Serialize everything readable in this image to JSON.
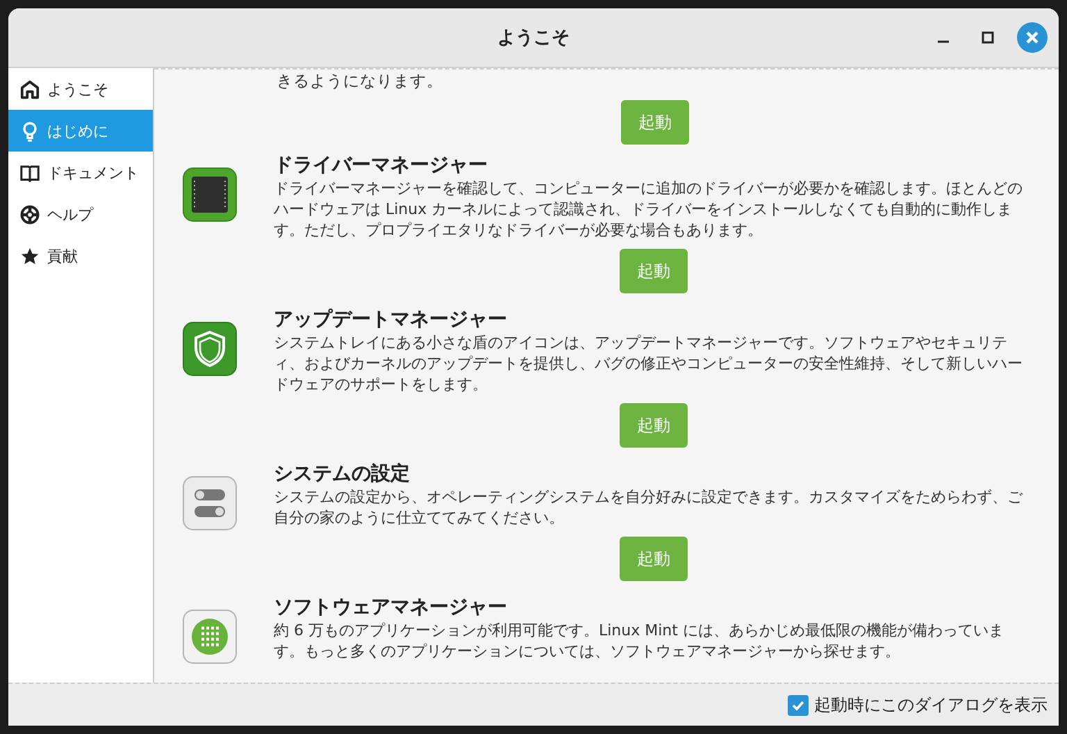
{
  "window": {
    "title": "ようこそ"
  },
  "sidebar": {
    "items": [
      {
        "label": "ようこそ",
        "kind": "home",
        "selected": false
      },
      {
        "label": "はじめに",
        "kind": "bulb",
        "selected": true
      },
      {
        "label": "ドキュメント",
        "kind": "book",
        "selected": false
      },
      {
        "label": "ヘルプ",
        "kind": "help",
        "selected": false
      },
      {
        "label": "貢献",
        "kind": "star",
        "selected": false
      }
    ]
  },
  "content": {
    "lead_text": "きるようになります。",
    "lead_button": "起動",
    "sections": [
      {
        "kind": "driver",
        "title": "ドライバーマネージャー",
        "description": "ドライバーマネージャーを確認して、コンピューターに追加のドライバーが必要かを確認します。ほとんどのハードウェアは Linux カーネルによって認識され、ドライバーをインストールしなくても自動的に動作します。ただし、プロプライエタリなドライバーが必要な場合もあります。",
        "button": "起動"
      },
      {
        "kind": "shield",
        "title": "アップデートマネージャー",
        "description": "システムトレイにある小さな盾のアイコンは、アップデートマネージャーです。ソフトウェアやセキュリティ、およびカーネルのアップデートを提供し、バグの修正やコンピューターの安全性維持、そして新しいハードウェアのサポートをします。",
        "button": "起動"
      },
      {
        "kind": "settings",
        "title": "システムの設定",
        "description": "システムの設定から、オペレーティングシステムを自分好みに設定できます。カスタマイズをためらわず、ご自分の家のように仕立ててみてください。",
        "button": "起動"
      },
      {
        "kind": "software",
        "title": "ソフトウェアマネージャー",
        "description": "約 6 万ものアプリケーションが利用可能です。Linux Mint には、あらかじめ最低限の機能が備わっています。もっと多くのアプリケーションについては、ソフトウェアマネージャーから探せます。"
      }
    ]
  },
  "footer": {
    "checkbox": {
      "label": "起動時にこのダイアログを表示",
      "checked": true
    }
  }
}
